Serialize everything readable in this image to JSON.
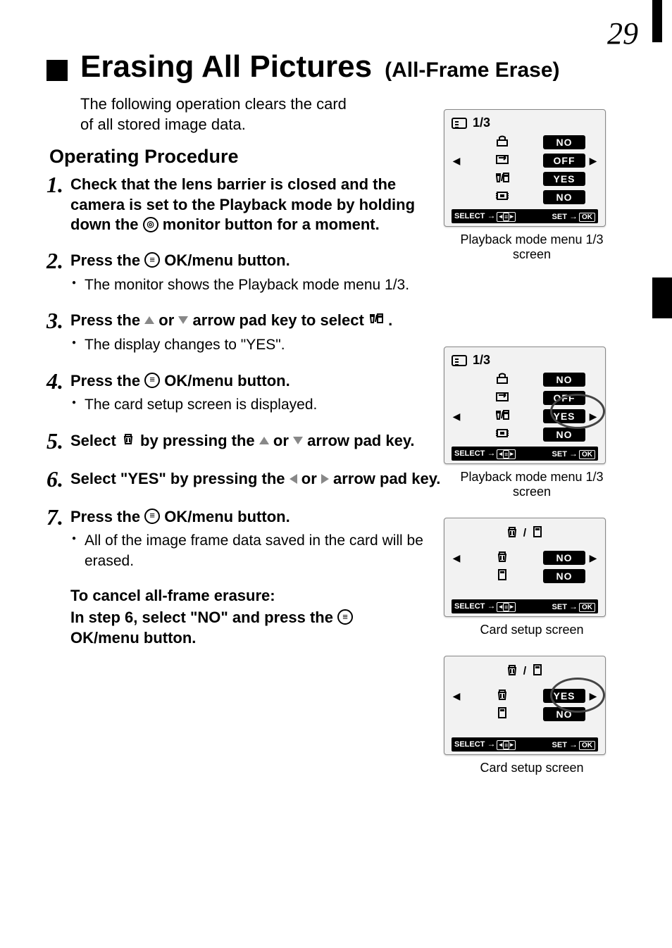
{
  "page_number": "29",
  "title": {
    "main": "Erasing All Pictures",
    "sub": "(All-Frame Erase)"
  },
  "intro": "The following operation clears the card of all stored image data.",
  "operating_procedure_label": "Operating Procedure",
  "steps": [
    {
      "num": "1",
      "head_pre": "Check that the lens barrier is closed and the camera is set to the Playback mode by holding down the ",
      "head_post": " monitor button for a moment.",
      "icon": "monitor",
      "subs": []
    },
    {
      "num": "2",
      "head_pre": "Press the ",
      "head_post": " OK/menu button.",
      "icon": "menu",
      "subs": [
        "The monitor shows the Playback mode menu 1/3."
      ]
    },
    {
      "num": "3",
      "head_parts": [
        "Press the ",
        " or ",
        " arrow pad key to select ",
        " ."
      ],
      "icons": [
        "up",
        "down",
        "trashcard"
      ],
      "subs": [
        "The display changes to \"YES\"."
      ]
    },
    {
      "num": "4",
      "head_pre": "Press the ",
      "head_post": " OK/menu button.",
      "icon": "menu",
      "subs": [
        "The card setup screen is displayed."
      ]
    },
    {
      "num": "5",
      "head_parts": [
        "Select ",
        " by pressing the ",
        " or ",
        " arrow pad key."
      ],
      "icons": [
        "trash",
        "up",
        "down"
      ],
      "subs": []
    },
    {
      "num": "6",
      "head_parts": [
        "Select \"YES\" by pressing the ",
        " or ",
        " arrow pad key."
      ],
      "icons": [
        "left",
        "right"
      ],
      "subs": []
    },
    {
      "num": "7",
      "head_pre": "Press the ",
      "head_post": " OK/menu button.",
      "icon": "menu",
      "subs": [
        "All of the image frame data saved in the card will be erased."
      ]
    }
  ],
  "cancel": {
    "title": "To cancel all-frame erasure:",
    "body_pre": "In step 6, select \"NO\" and press the ",
    "body_post": " OK/menu button."
  },
  "screens": {
    "footer_select": "SELECT",
    "footer_set": "SET",
    "footer_ok": "OK",
    "s1": {
      "page": "1/3",
      "rows": [
        {
          "icon": "protect",
          "value": "NO",
          "arrows": ""
        },
        {
          "icon": "rotate",
          "value": "OFF",
          "arrows": "lr"
        },
        {
          "icon": "trashcard",
          "value": "YES",
          "arrows": ""
        },
        {
          "icon": "chip",
          "value": "NO",
          "arrows": ""
        }
      ],
      "caption": "Playback mode menu 1/3 screen"
    },
    "s2": {
      "page": "1/3",
      "rows": [
        {
          "icon": "protect",
          "value": "NO",
          "arrows": ""
        },
        {
          "icon": "rotate",
          "value": "OFF",
          "arrows": ""
        },
        {
          "icon": "trashcard",
          "value": "YES",
          "arrows": "lr",
          "circled": true
        },
        {
          "icon": "chip",
          "value": "NO",
          "arrows": ""
        }
      ],
      "caption": "Playback mode menu 1/3 screen"
    },
    "s3": {
      "rows": [
        {
          "icon": "trash",
          "value": "NO",
          "arrows": "lr"
        },
        {
          "icon": "card",
          "value": "NO",
          "arrows": ""
        }
      ],
      "caption": "Card setup screen"
    },
    "s4": {
      "rows": [
        {
          "icon": "trash",
          "value": "YES",
          "arrows": "lr",
          "circled": true
        },
        {
          "icon": "card",
          "value": "NO",
          "arrows": ""
        }
      ],
      "caption": "Card setup screen"
    }
  }
}
